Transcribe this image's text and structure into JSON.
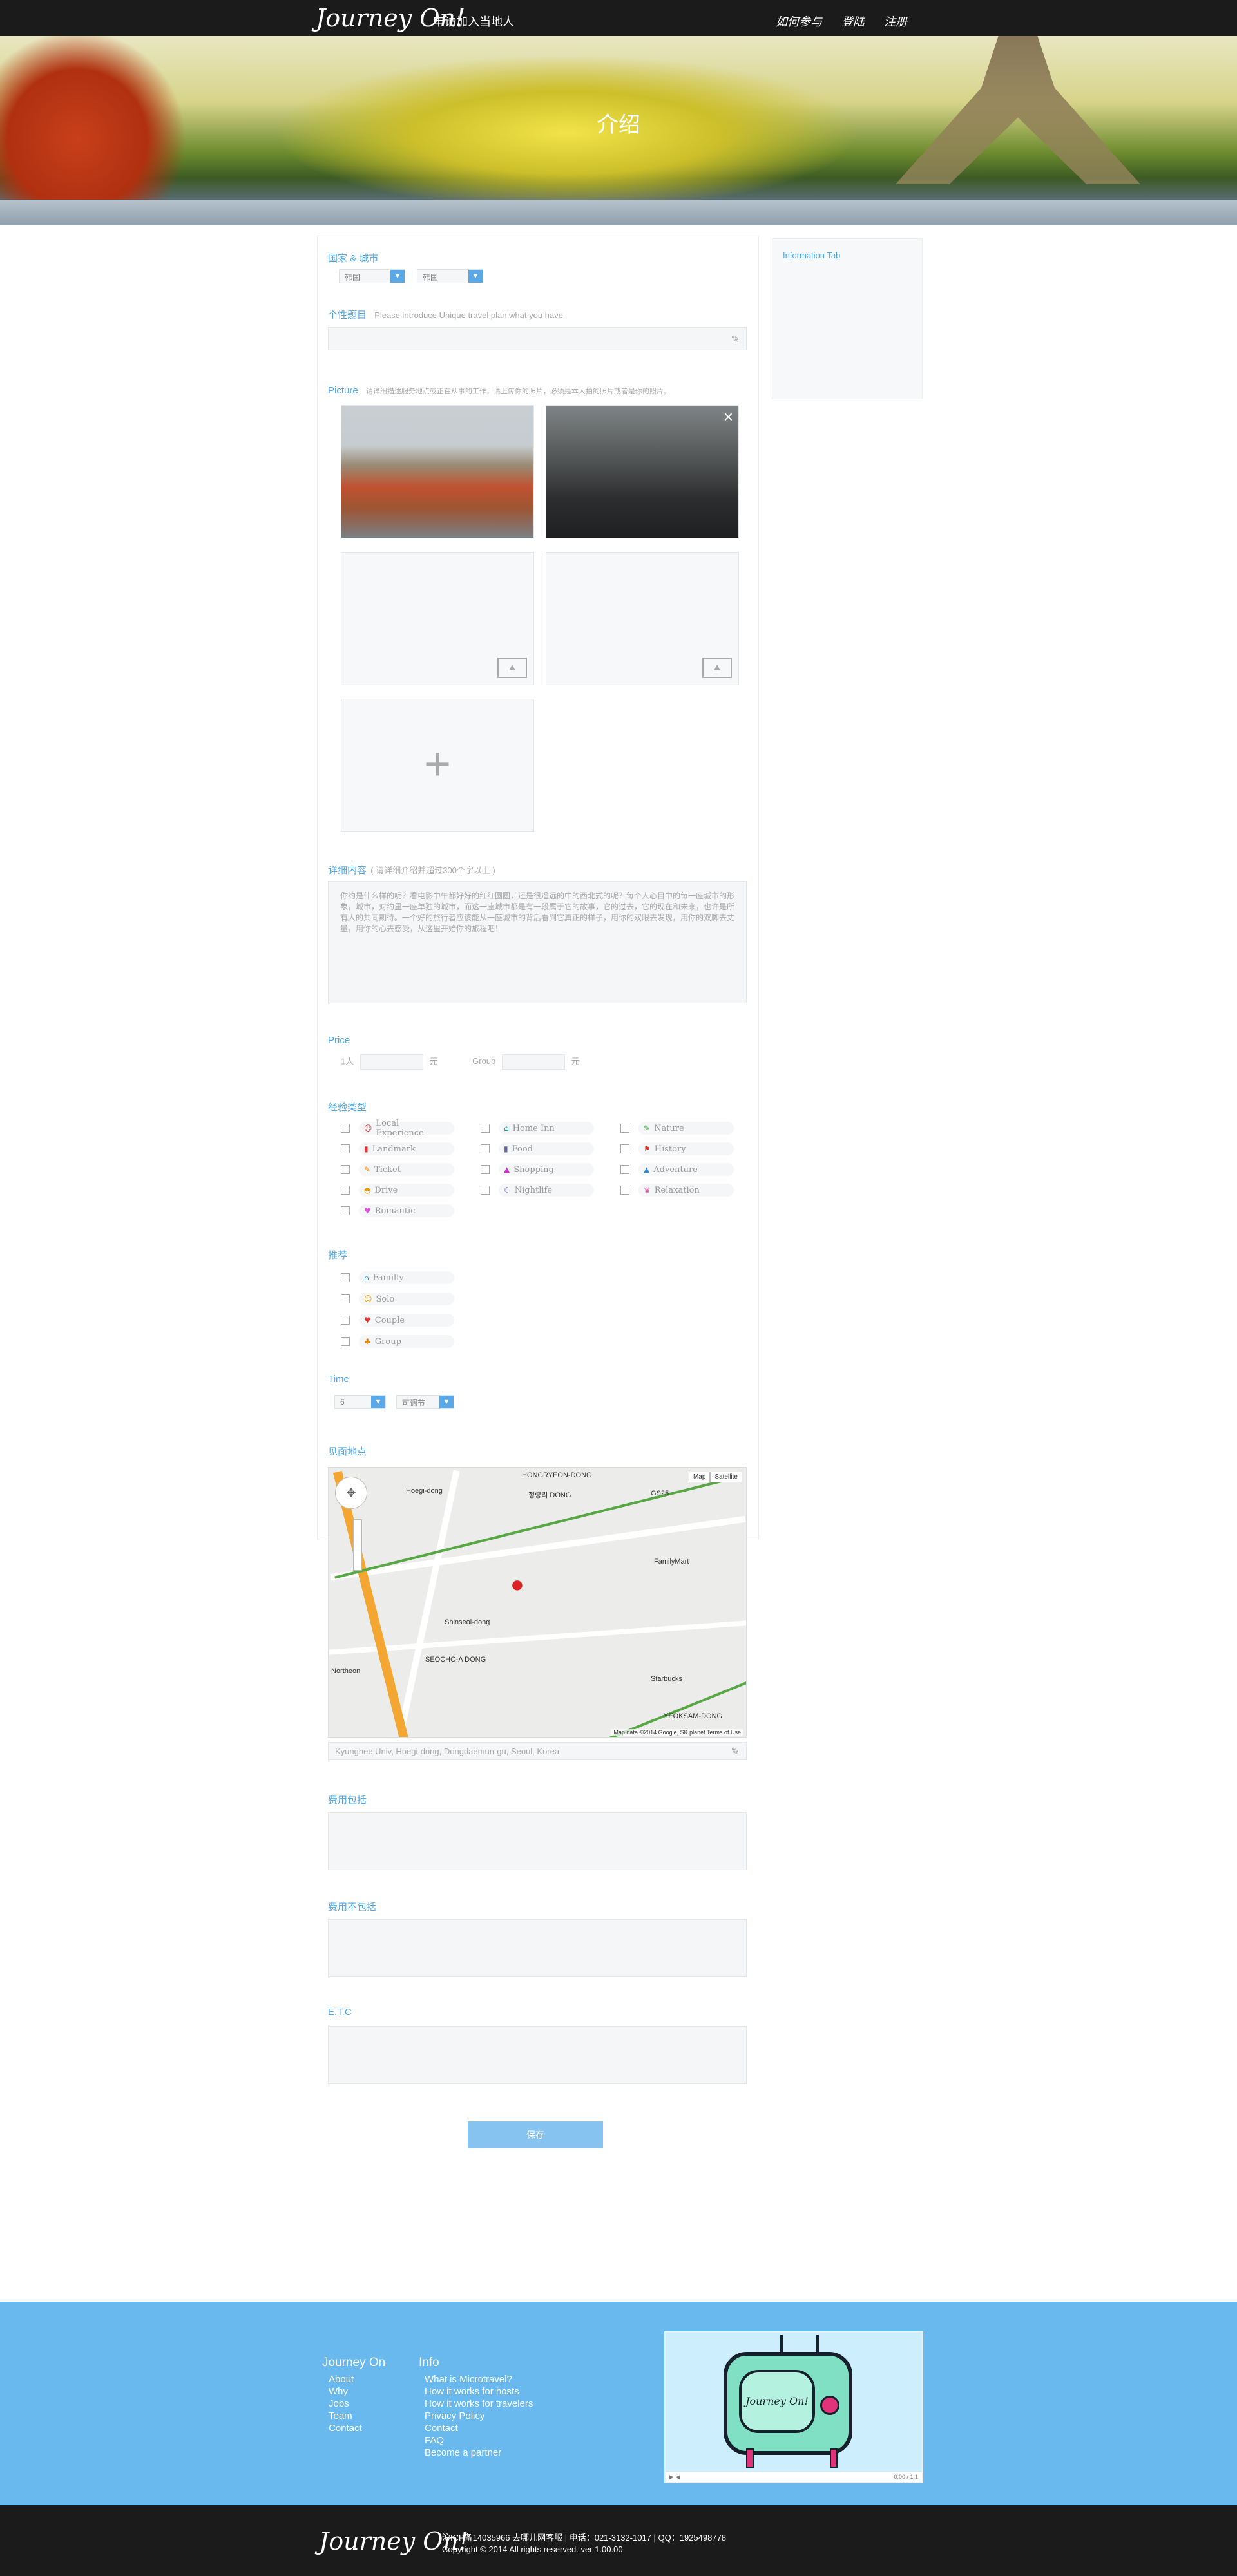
{
  "header": {
    "logo": "Journey On!",
    "apply_link": "申请加入当地人",
    "nav": [
      "如何参与",
      "登陆",
      "注册"
    ]
  },
  "hero": {
    "title": "介绍"
  },
  "country_city": {
    "title": "国家 & 城市",
    "country": "韩国",
    "city": "韩国"
  },
  "personal_title": {
    "title": "个性题目",
    "placeholder": "Please introduce Unique travel plan what you have"
  },
  "picture": {
    "title": "Picture",
    "hint": "请详细描述服务地点或正在从事的工作，请上传你的照片，必须是本人拍的照片或者是你的照片。"
  },
  "details": {
    "title": "详细内容",
    "hint": "( 请详细介绍并超过300个字以上 )",
    "body": "你约是什么样的呢？看电影中午都好好的红红圆圆，还是很遥远的中的西北式的呢？每个人心目中的每一座城市的形象，城市，对约里一座单独的城市，而这一座城市都是有一段属于它的故事，它的过去，它的现在和未来，也许是所有人的共同期待。一个好的旅行者应该能从一座城市的背后看到它真正的样子，用你的双眼去发现，用你的双脚去丈量，用你的心去感受，从这里开始你的旅程吧！"
  },
  "price": {
    "title": "Price",
    "per_person_label": "1人",
    "currency": "元",
    "group_label": "Group",
    "group_currency": "元"
  },
  "experience": {
    "title": "经验类型",
    "items": [
      {
        "label": "Local Experience",
        "icon": "☺",
        "color": "#d43"
      },
      {
        "label": "Home Inn",
        "icon": "⌂",
        "color": "#1a9"
      },
      {
        "label": "Nature",
        "icon": "✎",
        "color": "#3a3"
      },
      {
        "label": "Landmark",
        "icon": "▮",
        "color": "#d33"
      },
      {
        "label": "Food",
        "icon": "▮",
        "color": "#669"
      },
      {
        "label": "History",
        "icon": "⚑",
        "color": "#d33"
      },
      {
        "label": "Ticket",
        "icon": "✎",
        "color": "#e80"
      },
      {
        "label": "Shopping",
        "icon": "▲",
        "color": "#c3c"
      },
      {
        "label": "Adventure",
        "icon": "▲",
        "color": "#38c"
      },
      {
        "label": "Drive",
        "icon": "◓",
        "color": "#e90"
      },
      {
        "label": "Nightlife",
        "icon": "☾",
        "color": "#66c"
      },
      {
        "label": "Relaxation",
        "icon": "♛",
        "color": "#d59"
      },
      {
        "label": "Romantic",
        "icon": "♥",
        "color": "#d5d"
      }
    ]
  },
  "recommend": {
    "title": "推荐",
    "items": [
      {
        "label": "Familly",
        "icon": "⌂",
        "color": "#38c"
      },
      {
        "label": "Solo",
        "icon": "☺",
        "color": "#e90"
      },
      {
        "label": "Couple",
        "icon": "♥",
        "color": "#d33"
      },
      {
        "label": "Group",
        "icon": "♣",
        "color": "#e80"
      }
    ]
  },
  "time": {
    "title": "Time",
    "hours": "6",
    "unit": "可调节"
  },
  "meeting": {
    "title": "见面地点",
    "address": "Kyunghee Univ, Hoegi-dong, Dongdaemun-gu, Seoul, Korea",
    "map_btns": [
      "Map",
      "Satellite"
    ],
    "map_attrib": "Map data ©2014 Google, SK planet   Terms of Use",
    "map_labels": [
      "HONGRYEON-DONG",
      "청량리 DONG",
      "GS25",
      "Hoegi-dong",
      "FamilyMart",
      "Shinseol-dong",
      "SEOCHO-A DONG",
      "Starbucks",
      "YEOKSAM-DONG",
      "Northeon"
    ]
  },
  "fee_included": {
    "title": "费用包括"
  },
  "fee_excluded": {
    "title": "费用不包括"
  },
  "etc": {
    "title": "E.T.C"
  },
  "save_button": "保存",
  "side": {
    "title": "Information Tab"
  },
  "footer": {
    "col1_title": "Journey On",
    "col1_links": [
      "About",
      "Why",
      "Jobs",
      "Team",
      "Contact"
    ],
    "col2_title": "Info",
    "col2_links": [
      "What is Microtravel?",
      "How it works for hosts",
      "How it works for travelers",
      "Privacy Policy",
      "Contact",
      "FAQ",
      "Become a partner"
    ],
    "video_logo": "Journey On!",
    "video_time": "0:00 / 1:1"
  },
  "bottom": {
    "logo": "Journey On!",
    "line1": "沪ICP备14035966 去哪儿网客服 | 电话：021-3132-1017 | QQ：1925498778",
    "line2": "Copyright © 2014 All rights reserved. ver 1.00.00"
  }
}
